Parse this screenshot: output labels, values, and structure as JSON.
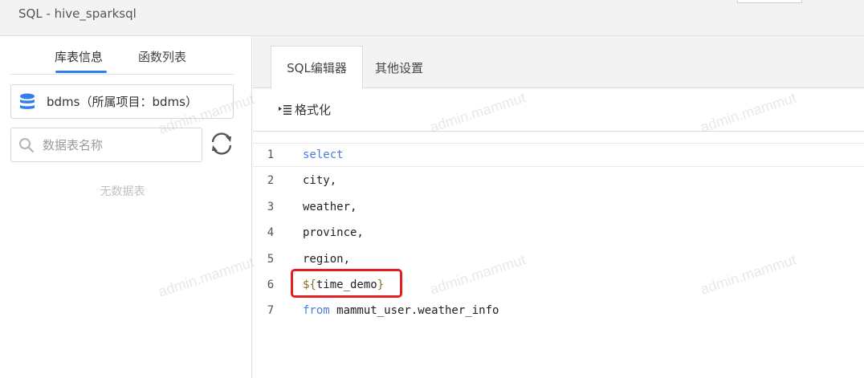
{
  "window": {
    "title": "SQL - hive_sparksql"
  },
  "left_panel": {
    "tabs": [
      {
        "label": "库表信息",
        "active": true
      },
      {
        "label": "函数列表",
        "active": false
      }
    ],
    "database_selector": {
      "label": "bdms（所属项目：bdms）",
      "icon": "database-icon"
    },
    "search": {
      "placeholder": "数据表名称",
      "value": ""
    },
    "empty_text": "无数据表"
  },
  "right_panel": {
    "tabs": [
      {
        "label": "SQL编辑器",
        "active": true
      },
      {
        "label": "其他设置",
        "active": false
      }
    ],
    "toolbar": {
      "format_label": "格式化"
    },
    "editor": {
      "lines": [
        {
          "number": "1",
          "text": "select"
        },
        {
          "number": "2",
          "text": "city,"
        },
        {
          "number": "3",
          "text": "weather,"
        },
        {
          "number": "4",
          "text": "province,"
        },
        {
          "number": "5",
          "text": "region,"
        },
        {
          "number": "6",
          "text": "${time_demo}"
        },
        {
          "number": "7",
          "text": "from mammut_user.weather_info"
        }
      ],
      "line7_keyword": "from",
      "line7_rest": " mammut_user.weather_info",
      "line6_open": "${",
      "line6_var": "time_demo",
      "line6_close": "}"
    }
  },
  "watermark": {
    "text": "admin.mammut"
  },
  "colors": {
    "accent": "#2f80ed",
    "keyword": "#4c7bd9",
    "annotation": "#e02020"
  }
}
